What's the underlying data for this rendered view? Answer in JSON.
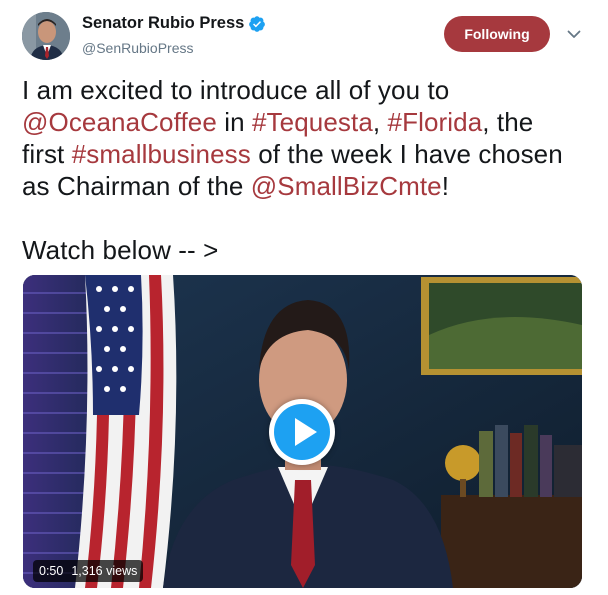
{
  "author": {
    "display_name": "Senator Rubio Press",
    "handle": "@SenRubioPress",
    "verified": true
  },
  "follow_button": {
    "label": "Following"
  },
  "menu": {
    "icon": "chevron-down-icon"
  },
  "tweet": {
    "line1": "I am excited to introduce all of you to",
    "line2_mention": "@OceanaCoffee",
    "line2_in": " in ",
    "line2_tag1": "#Tequesta",
    "line2_comma": ", ",
    "line2_tag2": "#Florida",
    "line2_end": ", the",
    "line3_start": "first ",
    "line3_tag": "#smallbusiness",
    "line3_end": " of the week I have chosen",
    "line4_start": "as Chairman of the ",
    "line4_mention": "@SmallBizCmte",
    "line4_end": "!",
    "line5": "Watch below -- >"
  },
  "video": {
    "duration": "0:50",
    "views": "1,316 views",
    "play_icon": "play-icon"
  },
  "colors": {
    "accent": "#a6393e",
    "play_blue": "#1da1f2",
    "verified_blue": "#1da1f2",
    "text": "#14171a",
    "muted": "#657786"
  }
}
